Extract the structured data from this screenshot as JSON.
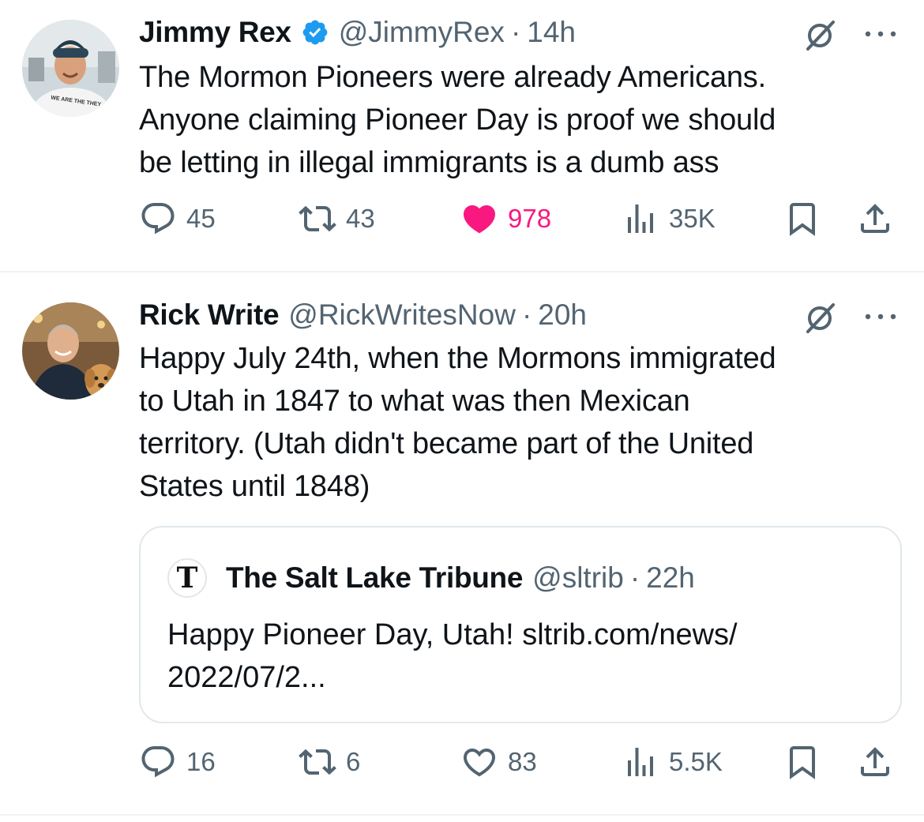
{
  "tweets": [
    {
      "display_name": "Jimmy Rex",
      "verified": true,
      "handle": "@JimmyRex",
      "separator": "·",
      "time": "14h",
      "text": "The Mormon Pioneers were already Americans.\nAnyone claiming Pioneer Day is proof we should\nbe letting in illegal immigrants is a dumb ass",
      "avatar_shirt_text": "WE ARE THE THEY",
      "stats": {
        "replies": "45",
        "reposts": "43",
        "likes": "978",
        "views": "35K"
      },
      "liked": true
    },
    {
      "display_name": "Rick Write",
      "verified": false,
      "handle": "@RickWritesNow",
      "separator": "·",
      "time": "20h",
      "text": "Happy July 24th, when the Mormons immigrated\nto Utah in 1847 to what was then Mexican\nterritory.  (Utah didn't became part of the United\nStates until  1848)",
      "quote": {
        "logo_letter": "T",
        "display_name": "The Salt Lake Tribune",
        "handle": "@sltrib",
        "separator": "·",
        "time": "22h",
        "text": "Happy Pioneer Day, Utah! sltrib.com/news/\n2022/07/2..."
      },
      "stats": {
        "replies": "16",
        "reposts": "6",
        "likes": "83",
        "views": "5.5K"
      },
      "liked": false
    }
  ],
  "icons": {
    "reply": "reply-bubble-icon",
    "repost": "repost-arrows-icon",
    "like": "heart-icon",
    "views": "views-bar-chart-icon",
    "bookmark": "bookmark-icon",
    "share": "share-upload-icon",
    "grok": "grok-slash-circle-icon",
    "more": "more-dots-icon",
    "verified": "verified-badge-icon"
  },
  "colors": {
    "text": "#0f1419",
    "secondary": "#536471",
    "like_active": "#f91880",
    "verified": "#1d9bf0",
    "divider": "#eff3f4"
  }
}
